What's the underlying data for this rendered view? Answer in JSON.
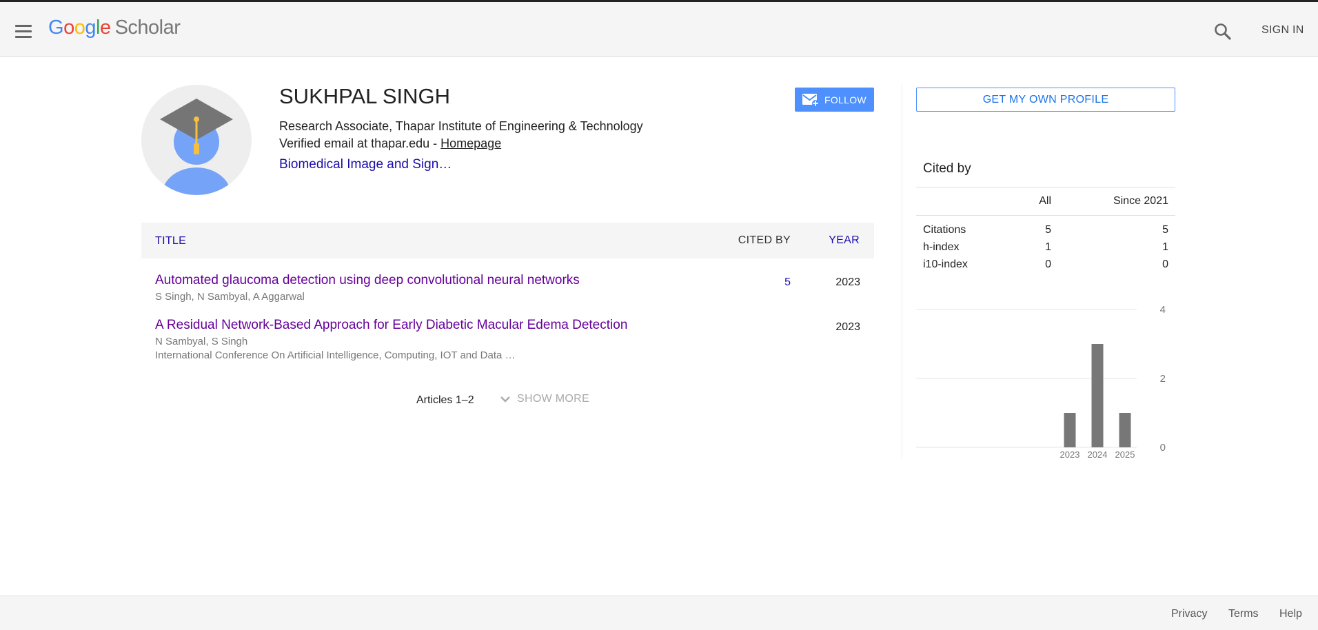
{
  "header": {
    "logo_google_letters": [
      "G",
      "o",
      "o",
      "g",
      "l",
      "e"
    ],
    "logo_scholar": "Scholar",
    "sign_in_label": "SIGN IN"
  },
  "profile": {
    "name": "SUKHPAL SINGH",
    "affiliation": "Research Associate, Thapar Institute of Engineering & Technology",
    "email_text": "Verified email at thapar.edu - ",
    "homepage_label": "Homepage",
    "interest": "Biomedical Image and Sign…",
    "follow_label": "FOLLOW"
  },
  "table": {
    "col_title": "TITLE",
    "col_cited_by": "CITED BY",
    "col_year": "YEAR",
    "rows": [
      {
        "title": "Automated glaucoma detection using deep convolutional neural networks",
        "authors": "S Singh, N Sambyal, A Aggarwal",
        "venue": "",
        "cited_by": "5",
        "year": "2023"
      },
      {
        "title": "A Residual Network-Based Approach for Early Diabetic Macular Edema Detection",
        "authors": "N Sambyal, S Singh",
        "venue": "International Conference On Artificial Intelligence, Computing, IOT and Data …",
        "cited_by": "",
        "year": "2023"
      }
    ],
    "articles_count": "Articles 1–2",
    "show_more_label": "SHOW MORE"
  },
  "sidebar": {
    "get_profile_label": "GET MY OWN PROFILE",
    "cited_by_title": "Cited by",
    "stats_header": {
      "all": "All",
      "since": "Since 2021"
    },
    "stats": [
      {
        "label": "Citations",
        "all": "5",
        "since": "5"
      },
      {
        "label": "h-index",
        "all": "1",
        "since": "1"
      },
      {
        "label": "i10-index",
        "all": "0",
        "since": "0"
      }
    ]
  },
  "chart_data": {
    "type": "bar",
    "categories": [
      "2023",
      "2024",
      "2025"
    ],
    "values": [
      1,
      3,
      1
    ],
    "ylim": [
      0,
      4
    ],
    "yticks": [
      "0",
      "2",
      "4"
    ],
    "bar_color": "#777777",
    "grid": true
  },
  "footer": {
    "links": [
      "Privacy",
      "Terms",
      "Help"
    ]
  },
  "colors": {
    "link_blue": "#1a0dab",
    "visited_purple": "#660099",
    "accent_blue": "#4d90fe"
  }
}
